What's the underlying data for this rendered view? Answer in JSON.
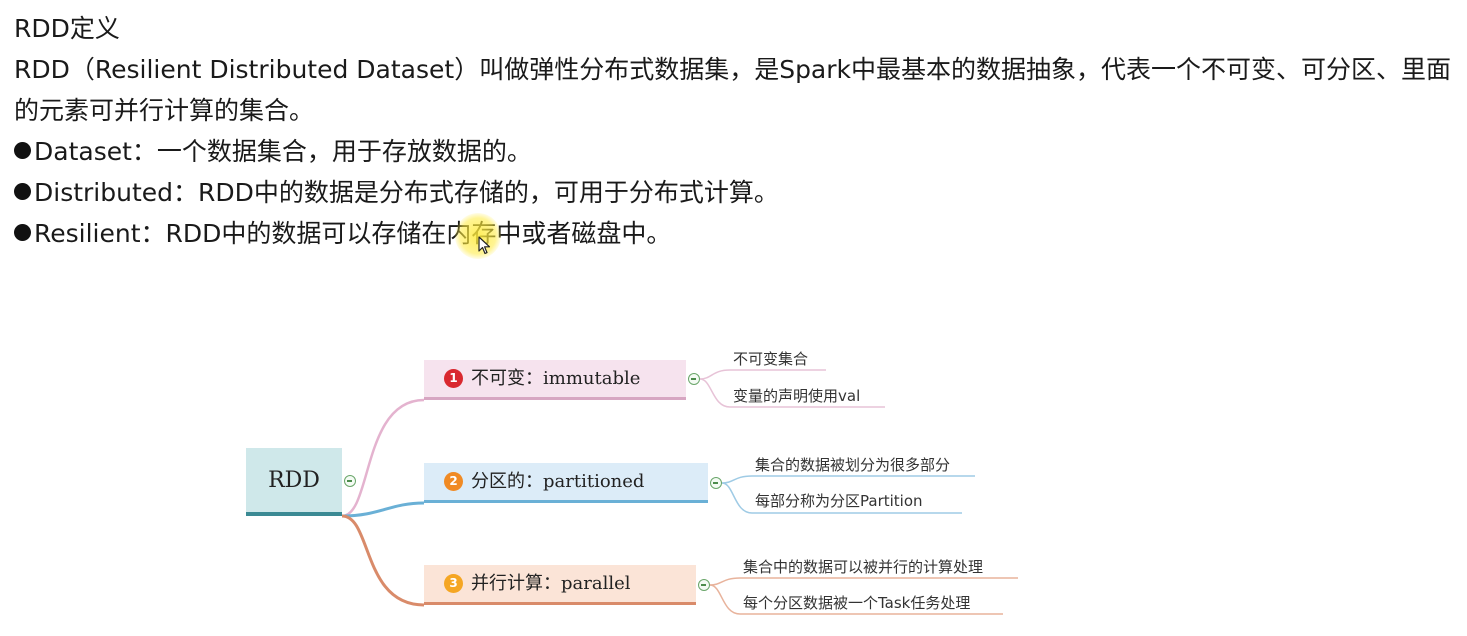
{
  "heading": "RDD定义",
  "definition": "RDD（Resilient Distributed Dataset）叫做弹性分布式数据集，是Spark中最基本的数据抽象，代表一个不可变、可分区、里面的元素可并行计算的集合。",
  "bullets": [
    "Dataset：一个数据集合，用于存放数据的。",
    "Distributed：RDD中的数据是分布式存储的，可用于分布式计算。",
    "Resilient：RDD中的数据可以存储在内存中或者磁盘中。"
  ],
  "mindmap": {
    "root": "RDD",
    "branches": [
      {
        "number": "1",
        "label": "不可变：immutable",
        "color": "#d9282f",
        "children": [
          "不可变集合",
          "变量的声明使用val"
        ]
      },
      {
        "number": "2",
        "label": "分区的：partitioned",
        "color": "#f08a24",
        "children": [
          "集合的数据被划分为很多部分",
          "每部分称为分区Partition"
        ]
      },
      {
        "number": "3",
        "label": "并行计算：parallel",
        "color": "#f5a623",
        "children": [
          "集合中的数据可以被并行的计算处理",
          "每个分区数据被一个Task任务处理"
        ]
      }
    ]
  }
}
